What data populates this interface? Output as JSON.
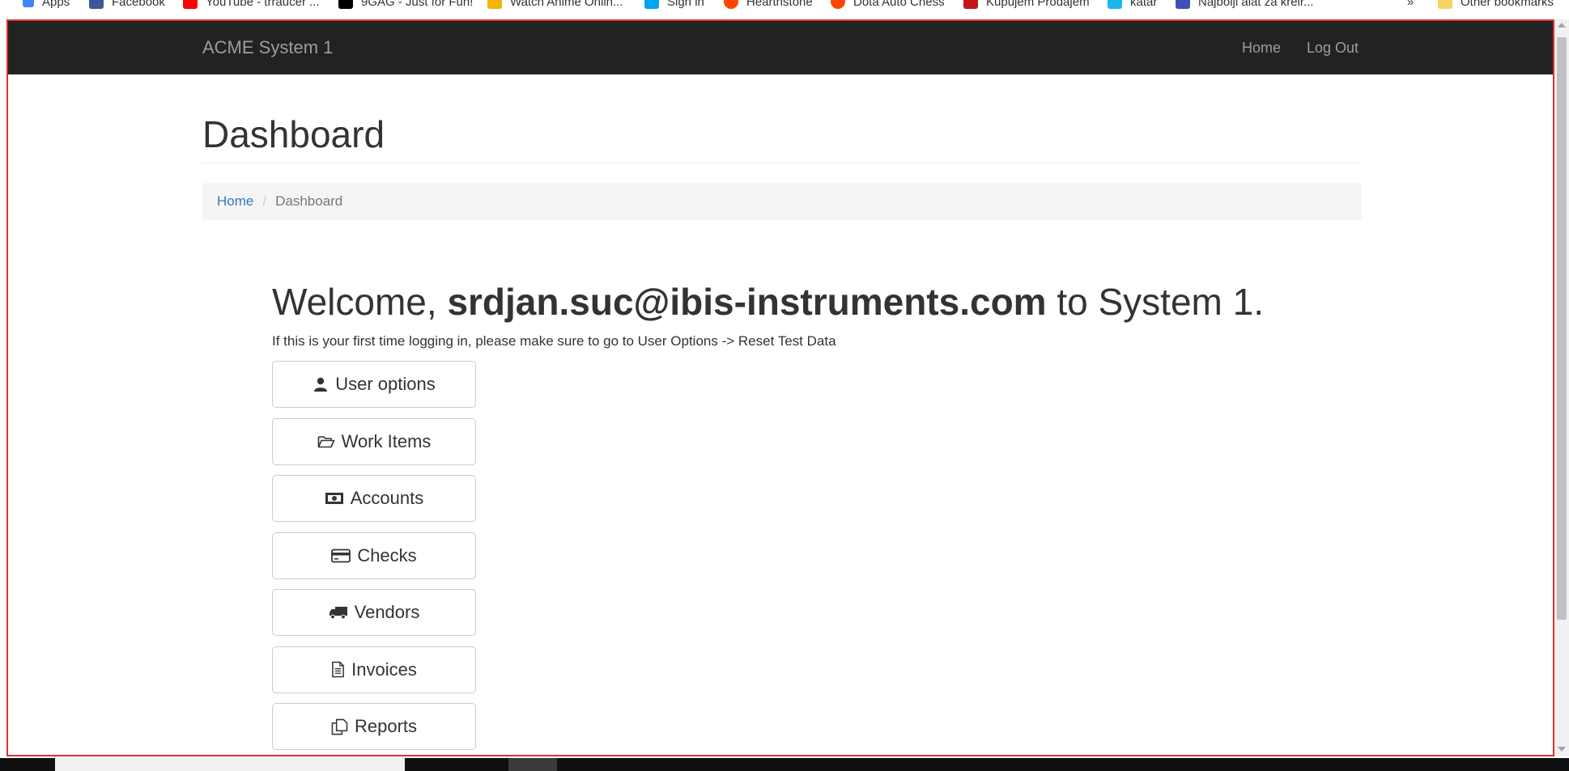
{
  "browser": {
    "bookmarks": [
      {
        "label": "Apps",
        "color": "#4285f4"
      },
      {
        "label": "Facebook",
        "color": "#3b5998"
      },
      {
        "label": "YouTube - trraucer ...",
        "color": "#ff0000"
      },
      {
        "label": "9GAG - Just for Fun!",
        "color": "#000000"
      },
      {
        "label": "Watch Anime Onlin...",
        "color": "#f4b400"
      },
      {
        "label": "Sign in",
        "color": "#00a4ef"
      },
      {
        "label": "Hearthstone",
        "color": "#ff4500"
      },
      {
        "label": "Dota Auto Chess",
        "color": "#ff4500"
      },
      {
        "label": "Kupujem Prodajem",
        "color": "#c4151c"
      },
      {
        "label": "katar",
        "color": "#1ab7ea"
      },
      {
        "label": "Najbolji alat za kreir...",
        "color": "#3f51b5"
      }
    ],
    "more": "»",
    "other_bookmarks": "Other bookmarks"
  },
  "navbar": {
    "brand": "ACME System 1",
    "links": [
      "Home",
      "Log Out"
    ]
  },
  "page": {
    "title": "Dashboard",
    "breadcrumb": {
      "home": "Home",
      "separator": "/",
      "current": "Dashboard"
    },
    "welcome": {
      "prefix": "Welcome, ",
      "user": "srdjan.suc@ibis-instruments.com",
      "suffix": " to System 1."
    },
    "hint": "If this is your first time logging in, please make sure to go to User Options -> Reset Test Data"
  },
  "menu": [
    {
      "label": "User options",
      "icon": "user-icon"
    },
    {
      "label": "Work Items",
      "icon": "folder-open-icon"
    },
    {
      "label": "Accounts",
      "icon": "money-icon"
    },
    {
      "label": "Checks",
      "icon": "credit-card-icon"
    },
    {
      "label": "Vendors",
      "icon": "truck-icon"
    },
    {
      "label": "Invoices",
      "icon": "file-text-icon"
    },
    {
      "label": "Reports",
      "icon": "copy-icon"
    }
  ],
  "colors": {
    "navbar": "#222222",
    "link": "#337ab7",
    "frame_outline": "#e0302c"
  }
}
